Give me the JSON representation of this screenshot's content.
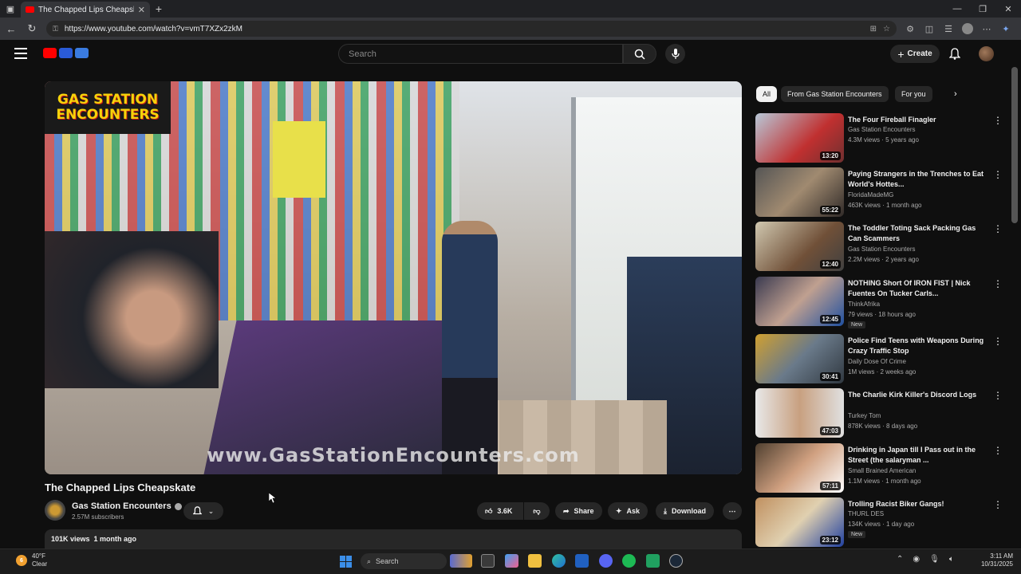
{
  "browser": {
    "tab_title": "The Chapped Lips Cheapskate",
    "url": "https://www.youtube.com/watch?v=vmT7XZx2zkM"
  },
  "header": {
    "search_placeholder": "Search",
    "create_label": "Create"
  },
  "video": {
    "sign_line1": "GAS STATION",
    "sign_line2": "ENCOUNTERS",
    "watermark": "www.GasStationEncounters.com",
    "title": "The Chapped Lips Cheapskate",
    "channel": "Gas Station Encounters",
    "subscribers": "2.57M subscribers",
    "likes": "3.6K",
    "share_label": "Share",
    "ask_label": "Ask",
    "download_label": "Download",
    "views_date": "101K views  1 month ago"
  },
  "chips": [
    {
      "label": "All",
      "active": true
    },
    {
      "label": "From Gas Station Encounters",
      "active": false
    },
    {
      "label": "For you",
      "active": false
    }
  ],
  "recommendations": [
    {
      "title": "The Four Fireball Finagler",
      "channel": "Gas Station Encounters",
      "meta": "4.3M views · 5 years ago",
      "duration": "13:20",
      "new": ""
    },
    {
      "title": "Paying Strangers in the Trenches to Eat World's Hottes...",
      "channel": "FloridaMadeMG",
      "meta": "463K views · 1 month ago",
      "duration": "55:22",
      "new": ""
    },
    {
      "title": "The Toddler Toting Sack Packing Gas Can Scammers",
      "channel": "Gas Station Encounters",
      "meta": "2.2M views · 2 years ago",
      "duration": "12:40",
      "new": ""
    },
    {
      "title": "NOTHING Short Of IRON FIST | Nick Fuentes On Tucker Carls...",
      "channel": "ThinkAfrika",
      "meta": "79 views · 18 hours ago",
      "duration": "12:45",
      "new": "New"
    },
    {
      "title": "Police Find Teens with Weapons During Crazy Traffic Stop",
      "channel": "Daily Dose Of Crime",
      "meta": "1M views · 2 weeks ago",
      "duration": "30:41",
      "new": ""
    },
    {
      "title": "The Charlie Kirk Killer's Discord Logs",
      "channel": "Turkey Tom",
      "meta": "878K views · 8 days ago",
      "duration": "47:03",
      "new": ""
    },
    {
      "title": "Drinking in Japan till I Pass out in the Street (the salaryman ...",
      "channel": "Small Brained American",
      "meta": "1.1M views · 1 month ago",
      "duration": "57:11",
      "new": ""
    },
    {
      "title": "Trolling Racist Biker Gangs!",
      "channel": "THURL DES",
      "meta": "134K views · 1 day ago",
      "duration": "23:12",
      "new": "New"
    }
  ],
  "taskbar": {
    "temp": "40°F",
    "weather": "Clear",
    "search": "Search",
    "time": "3:11 AM",
    "date": "10/31/2025",
    "weather_badge": "6"
  }
}
